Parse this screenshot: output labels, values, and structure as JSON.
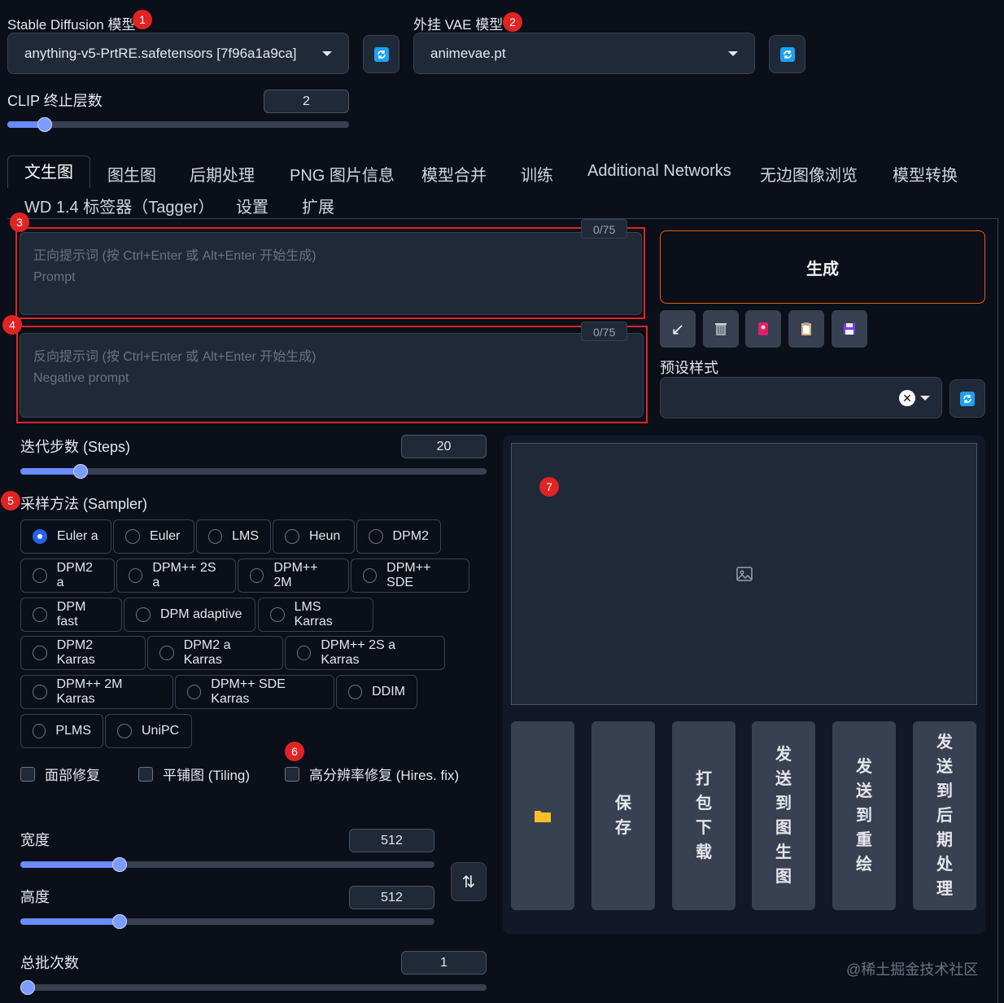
{
  "models": {
    "sd_label": "Stable Diffusion 模型",
    "sd_value": "anything-v5-PrtRE.safetensors [7f96a1a9ca]",
    "vae_label": "外挂 VAE 模型",
    "vae_value": "animevae.pt"
  },
  "clip": {
    "label": "CLIP 终止层数",
    "value": "2",
    "fraction": 0.11
  },
  "tabs": {
    "row1": [
      "文生图",
      "图生图",
      "后期处理",
      "PNG 图片信息",
      "模型合并",
      "训练",
      "Additional Networks",
      "无边图像浏览",
      "模型转换"
    ],
    "row2": [
      "WD 1.4 标签器（Tagger）",
      "设置",
      "扩展"
    ]
  },
  "prompt": {
    "placeholder_line1": "正向提示词 (按 Ctrl+Enter 或 Alt+Enter 开始生成)",
    "placeholder_line2": "Prompt",
    "counter": "0/75"
  },
  "negative_prompt": {
    "placeholder_line1": "反向提示词 (按 Ctrl+Enter 或 Alt+Enter 开始生成)",
    "placeholder_line2": "Negative prompt",
    "counter": "0/75"
  },
  "generate": {
    "label": "生成"
  },
  "tool_icons": [
    "arrow-down-left-icon",
    "trash-icon",
    "red-card-icon",
    "clipboard-icon",
    "floppy-disk-icon"
  ],
  "styles": {
    "label": "预设样式"
  },
  "steps": {
    "label": "迭代步数 (Steps)",
    "value": "20",
    "fraction": 0.13
  },
  "sampler": {
    "label": "采样方法 (Sampler)",
    "selected": "Euler a",
    "options": [
      "Euler a",
      "Euler",
      "LMS",
      "Heun",
      "DPM2",
      "DPM2 a",
      "DPM++ 2S a",
      "DPM++ 2M",
      "DPM++ SDE",
      "DPM fast",
      "DPM adaptive",
      "LMS Karras",
      "DPM2 Karras",
      "DPM2 a Karras",
      "DPM++ 2S a Karras",
      "DPM++ 2M Karras",
      "DPM++ SDE Karras",
      "DDIM",
      "PLMS",
      "UniPC"
    ]
  },
  "checkboxes": [
    "面部修复",
    "平铺图 (Tiling)",
    "高分辨率修复 (Hires. fix)"
  ],
  "width": {
    "label": "宽度",
    "value": "512",
    "fraction": 0.24
  },
  "height": {
    "label": "高度",
    "value": "512",
    "fraction": 0.24
  },
  "batch_count": {
    "label": "总批次数",
    "value": "1",
    "fraction": 0.0
  },
  "output_actions": [
    "保存",
    "打包下载",
    "发送到图生图",
    "发送到重绘",
    "发送到后期处理"
  ],
  "markers": [
    "1",
    "2",
    "3",
    "4",
    "5",
    "6",
    "7"
  ],
  "watermark": "@稀土掘金技术社区",
  "colors": {
    "accent": "#2563eb",
    "marker_red": "#e02424",
    "generate_border": "#ea580c"
  }
}
